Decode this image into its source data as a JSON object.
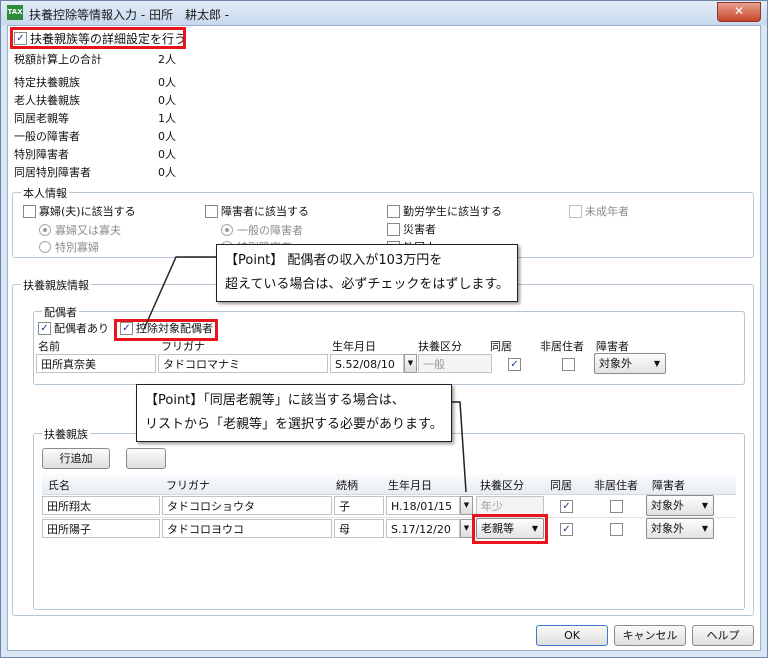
{
  "window": {
    "title": "扶養控除等情報入力 - 田所　耕太郎 -",
    "icon_label": "TAX",
    "close_symbol": "✕"
  },
  "detail_toggle": {
    "label": "扶養親族等の詳細設定を行う",
    "checked": true
  },
  "summary": [
    {
      "label": "税額計算上の合計",
      "value": "2人"
    },
    {
      "label": "特定扶養親族",
      "value": "0人"
    },
    {
      "label": "老人扶養親族",
      "value": "0人"
    },
    {
      "label": "同居老親等",
      "value": "1人"
    },
    {
      "label": "一般の障害者",
      "value": "0人"
    },
    {
      "label": "特別障害者",
      "value": "0人"
    },
    {
      "label": "同居特別障害者",
      "value": "0人"
    }
  ],
  "self_info": {
    "title": "本人情報",
    "widow": {
      "label": "寡婦(夫)に該当する",
      "options": [
        "寡婦又は寡夫",
        "特別寡婦"
      ]
    },
    "disabled": {
      "label": "障害者に該当する",
      "options": [
        "一般の障害者",
        "特別障害者"
      ]
    },
    "student": {
      "label": "勤労学生に該当する"
    },
    "disaster": {
      "label": "災害者"
    },
    "foreigner": {
      "label": "外国人"
    },
    "minor": {
      "label": "未成年者"
    }
  },
  "dependents_info": {
    "title": "扶養親族情報"
  },
  "spouse": {
    "title": "配偶者",
    "has_spouse": {
      "label": "配偶者あり",
      "checked": true
    },
    "deduction": {
      "label": "控除対象配偶者",
      "checked": true
    },
    "headers": [
      "名前",
      "フリガナ",
      "生年月日",
      "扶養区分",
      "同居",
      "非居住者",
      "障害者"
    ],
    "row": {
      "name": "田所真奈美",
      "kana": "タドコロマナミ",
      "birth": "S.52/08/10",
      "category": "一般",
      "cohabit": true,
      "nonresident": false,
      "disability": "対象外"
    }
  },
  "dependents": {
    "title": "扶養親族",
    "add_button": "行追加",
    "headers": [
      "氏名",
      "フリガナ",
      "続柄",
      "生年月日",
      "扶養区分",
      "同居",
      "非居住者",
      "障害者"
    ],
    "rows": [
      {
        "name": "田所翔太",
        "kana": "タドコロショウタ",
        "relation": "子",
        "birth": "H.18/01/15",
        "category": "年少",
        "cohabit": true,
        "nonresident": false,
        "disability": "対象外"
      },
      {
        "name": "田所陽子",
        "kana": "タドコロヨウコ",
        "relation": "母",
        "birth": "S.17/12/20",
        "category": "老親等",
        "cohabit": true,
        "nonresident": false,
        "disability": "対象外"
      }
    ]
  },
  "callouts": {
    "spouse": [
      "【Point】 配偶者の収入が103万円を",
      "超えている場合は、必ずチェックをはずします。"
    ],
    "parent": [
      "【Point】「同居老親等」に該当する場合は、",
      "リストから「老親等」を選択する必要があります。"
    ]
  },
  "footer": {
    "ok": "OK",
    "cancel": "キャンセル",
    "help": "ヘルプ"
  },
  "icons": {
    "checkmark": "✓",
    "dropdown": "▼"
  },
  "colors": {
    "highlight": "#e5151b",
    "checkmark": "#1a3b8f"
  }
}
